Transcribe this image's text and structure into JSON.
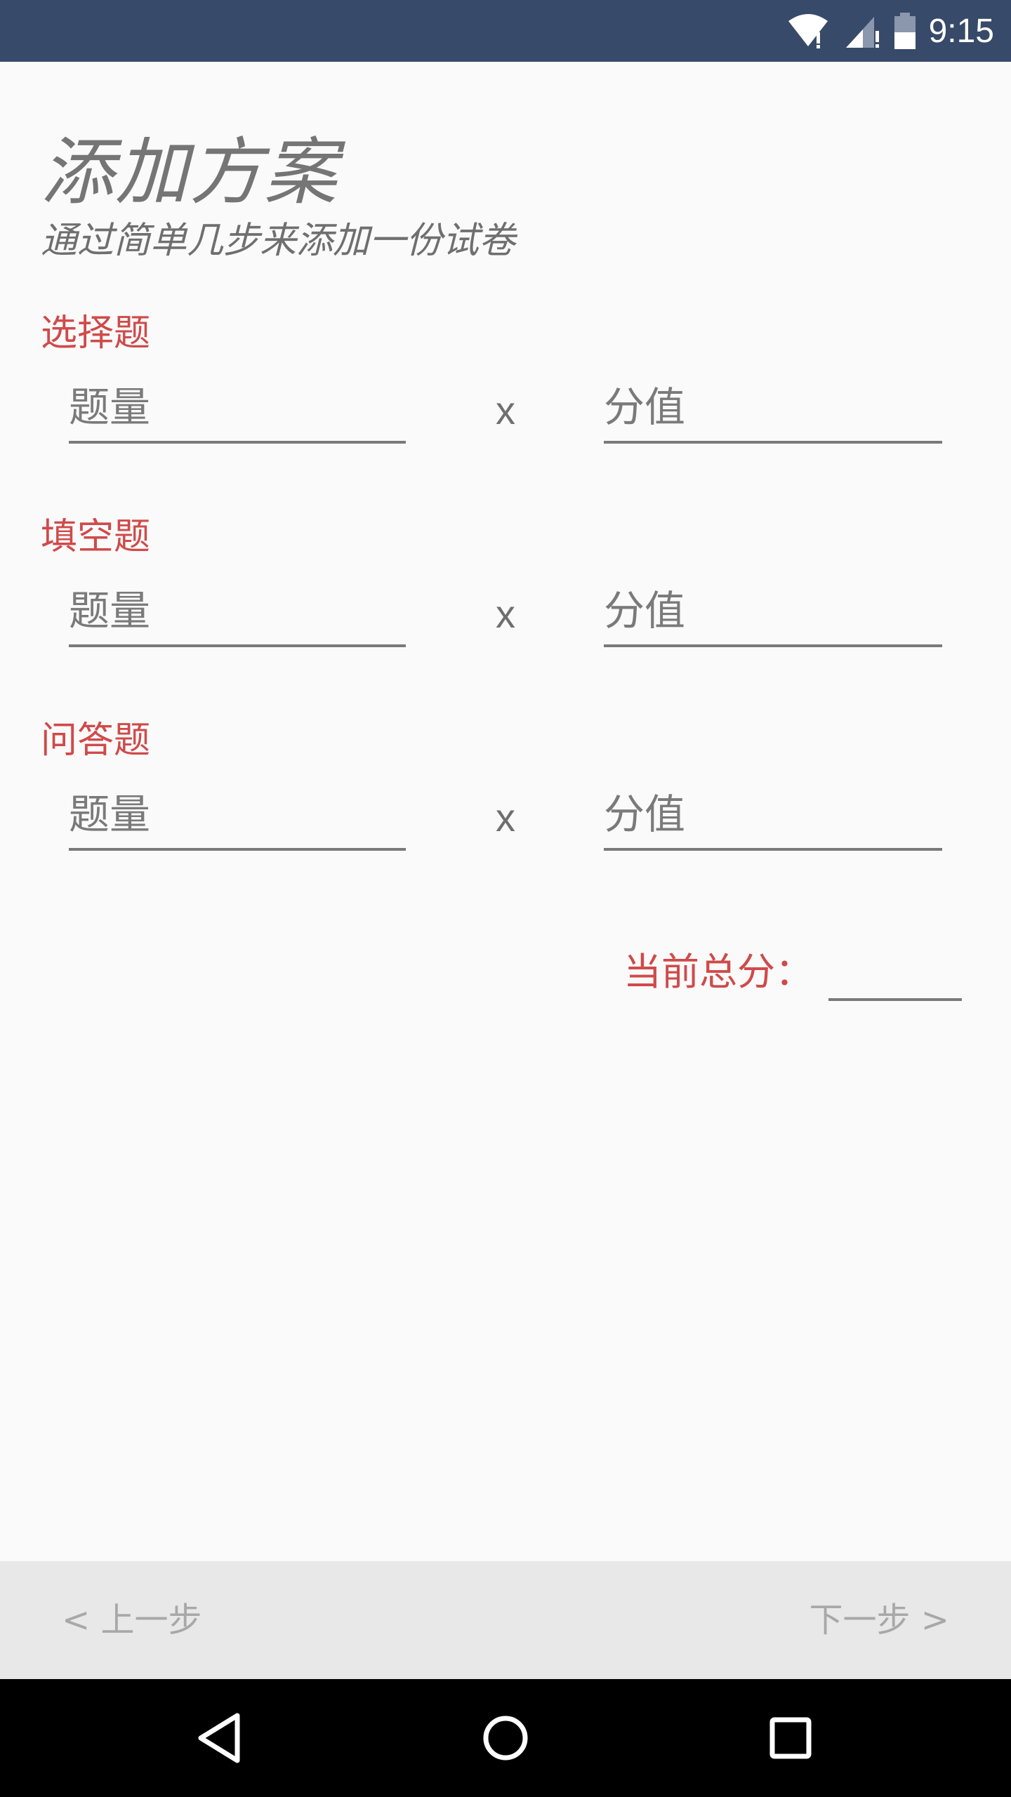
{
  "status_bar": {
    "time": "9:15",
    "icons": [
      "wifi-icon",
      "signal-icon",
      "battery-icon"
    ]
  },
  "header": {
    "title": "添加方案",
    "subtitle": "通过简单几步来添加一份试卷"
  },
  "sections": [
    {
      "label": "选择题",
      "count_placeholder": "题量",
      "times": "x",
      "score_placeholder": "分值"
    },
    {
      "label": "填空题",
      "count_placeholder": "题量",
      "times": "x",
      "score_placeholder": "分值"
    },
    {
      "label": "问答题",
      "count_placeholder": "题量",
      "times": "x",
      "score_placeholder": "分值"
    }
  ],
  "total": {
    "label": "当前总分：",
    "value": ""
  },
  "footer": {
    "prev_label": "< 上一步",
    "next_label": "下一步 >"
  },
  "colors": {
    "status_bar": "#384a69",
    "accent_red": "#d04a4a",
    "bottom_bar": "#e8e8e8"
  }
}
